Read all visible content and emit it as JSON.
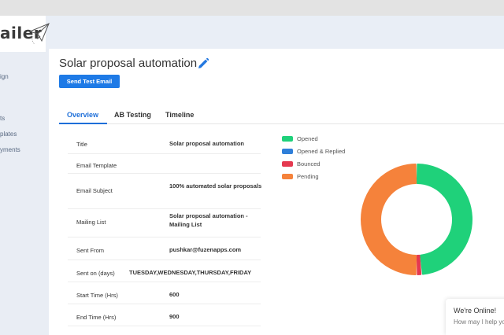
{
  "app": {
    "logo_text": "ailer"
  },
  "sidebar": {
    "items": [
      {
        "label": "ign"
      },
      {
        "label": "ts"
      },
      {
        "label": "plates"
      },
      {
        "label": "yments"
      }
    ]
  },
  "page": {
    "title": "Solar proposal automation",
    "send_test_label": "Send Test Email"
  },
  "tabs": [
    {
      "label": "Overview",
      "active": true
    },
    {
      "label": "AB Testing",
      "active": false
    },
    {
      "label": "Timeline",
      "active": false
    }
  ],
  "details": [
    {
      "label": "Title",
      "value": "Solar proposal automation"
    },
    {
      "label": "Email Template",
      "value": ""
    },
    {
      "label": "Email Subject",
      "value": "100% automated solar proposals"
    },
    {
      "label": "Mailing List",
      "value": "Solar proposal automation - Mailing List"
    },
    {
      "label": "Sent From",
      "value": "pushkar@fuzenapps.com"
    },
    {
      "label": "Sent on (days)",
      "value": "TUESDAY,WEDNESDAY,THURSDAY,FRIDAY"
    },
    {
      "label": "Start Time (Hrs)",
      "value": "600"
    },
    {
      "label": "End Time (Hrs)",
      "value": "900"
    }
  ],
  "chart_data": {
    "type": "pie",
    "categories": [
      "Opened",
      "Opened & Replied",
      "Bounced",
      "Pending"
    ],
    "values": [
      48.5,
      0,
      1.5,
      50
    ],
    "colors": [
      "#1fd17a",
      "#2f7fd9",
      "#e53950",
      "#f5823b"
    ],
    "legend": "top-left"
  },
  "chat": {
    "title": "We're Online!",
    "subtitle": "How may I help you"
  }
}
